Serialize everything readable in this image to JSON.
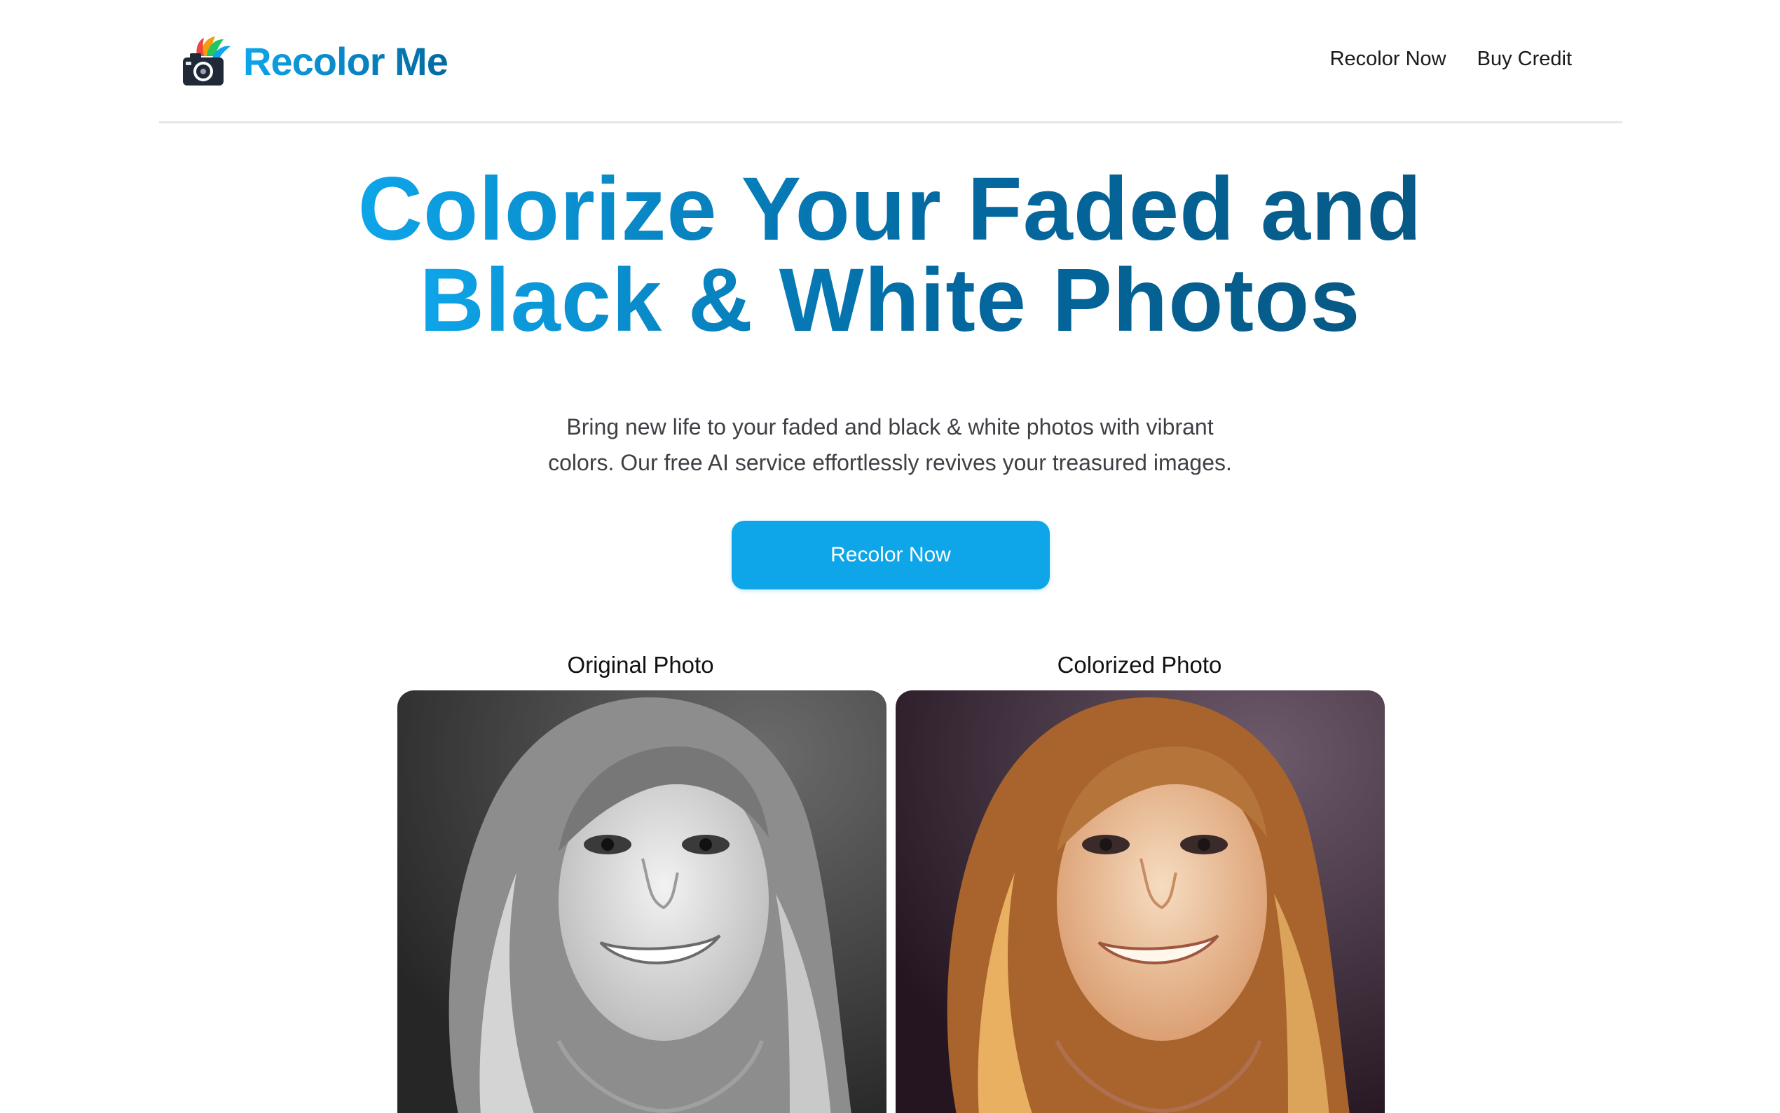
{
  "header": {
    "logo_text": "Recolor Me",
    "logo_icon": "camera-feather-icon",
    "nav": [
      {
        "label": "Recolor Now"
      },
      {
        "label": "Buy Credit"
      }
    ]
  },
  "hero": {
    "title_line1": "Colorize Your Faded and",
    "title_line2": "Black & White Photos",
    "subtitle_line1": "Bring new life to your faded and black & white photos with vibrant",
    "subtitle_line2": "colors. Our free AI service effortlessly revives your treasured images.",
    "cta_label": "Recolor Now"
  },
  "comparison": {
    "original_label": "Original Photo",
    "colorized_label": "Colorized Photo"
  },
  "colors": {
    "brand_light": "#0ea5e9",
    "brand_dark": "#0369a1",
    "cta_background": "#0ea5e9",
    "text_muted": "#3f3f46",
    "divider": "#e3e6ea"
  }
}
